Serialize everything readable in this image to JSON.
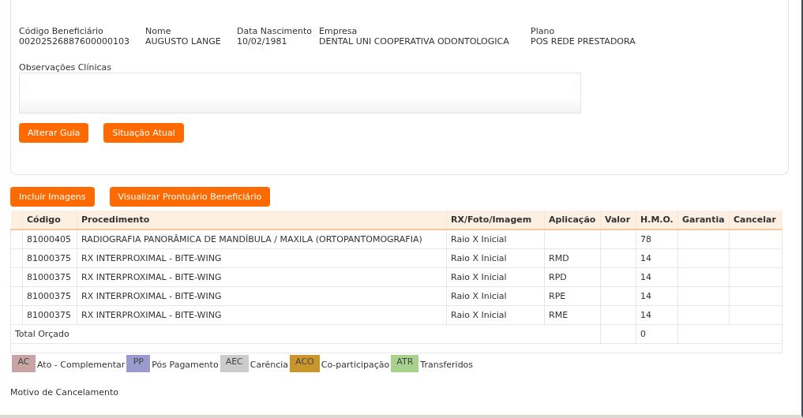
{
  "beneficiary_fields": [
    {
      "label": "Código Beneficiário",
      "value": "00202526887600000103"
    },
    {
      "label": "Nome",
      "value": "AUGUSTO LANGE"
    },
    {
      "label": "Data Nascimento",
      "value": "10/02/1981"
    },
    {
      "label": "Empresa",
      "value": "DENTAL UNI COOPERATIVA ODONTOLOGICA"
    },
    {
      "label": "Plano",
      "value": "POS REDE PRESTADORA"
    }
  ],
  "clinical_notes": {
    "label": "Observações Clínicas"
  },
  "card_buttons": [
    "Alterar Guia",
    "Situação Atual"
  ],
  "action_buttons": [
    "Incluir Imagens",
    "Visualizar Prontuário Beneficiário"
  ],
  "table": {
    "columns": [
      "",
      "Código",
      "Procedimento",
      "RX/Foto/Imagem",
      "Aplicação",
      "Valor",
      "H.M.O.",
      "Garantia",
      "Cancelar"
    ],
    "rows": [
      [
        "",
        "81000405",
        "RADIOGRAFIA PANORÂMICA DE MANDÍBULA / MAXILA (ORTOPANTOMOGRAFIA)",
        "Raio X Inicial",
        "",
        "",
        "78",
        "",
        ""
      ],
      [
        "",
        "81000375",
        "RX INTERPROXIMAL - BITE-WING",
        "Raio X Inicial",
        "RMD",
        "",
        "14",
        "",
        ""
      ],
      [
        "",
        "81000375",
        "RX INTERPROXIMAL - BITE-WING",
        "Raio X Inicial",
        "RPD",
        "",
        "14",
        "",
        ""
      ],
      [
        "",
        "81000375",
        "RX INTERPROXIMAL - BITE-WING",
        "Raio X Inicial",
        "RPE",
        "",
        "14",
        "",
        ""
      ],
      [
        "",
        "81000375",
        "RX INTERPROXIMAL - BITE-WING",
        "Raio X Inicial",
        "RME",
        "",
        "14",
        "",
        ""
      ]
    ],
    "total": {
      "label": "Total Orçado",
      "hmo": "0"
    }
  },
  "legend": [
    {
      "code": "AC",
      "label": "Ato - Complementar",
      "color": "#c8a4a4"
    },
    {
      "code": "PP",
      "label": "Pós Pagamento",
      "color": "#9a9acc"
    },
    {
      "code": "AEC",
      "label": "Carência",
      "color": "#cccccc"
    },
    {
      "code": "ACO",
      "label": "Co-participação",
      "color": "#c9962c"
    },
    {
      "code": "ATR",
      "label": "Transferidos",
      "color": "#a9d18e"
    }
  ],
  "cancel_reason": {
    "label": "Motivo de Cancelamento"
  }
}
